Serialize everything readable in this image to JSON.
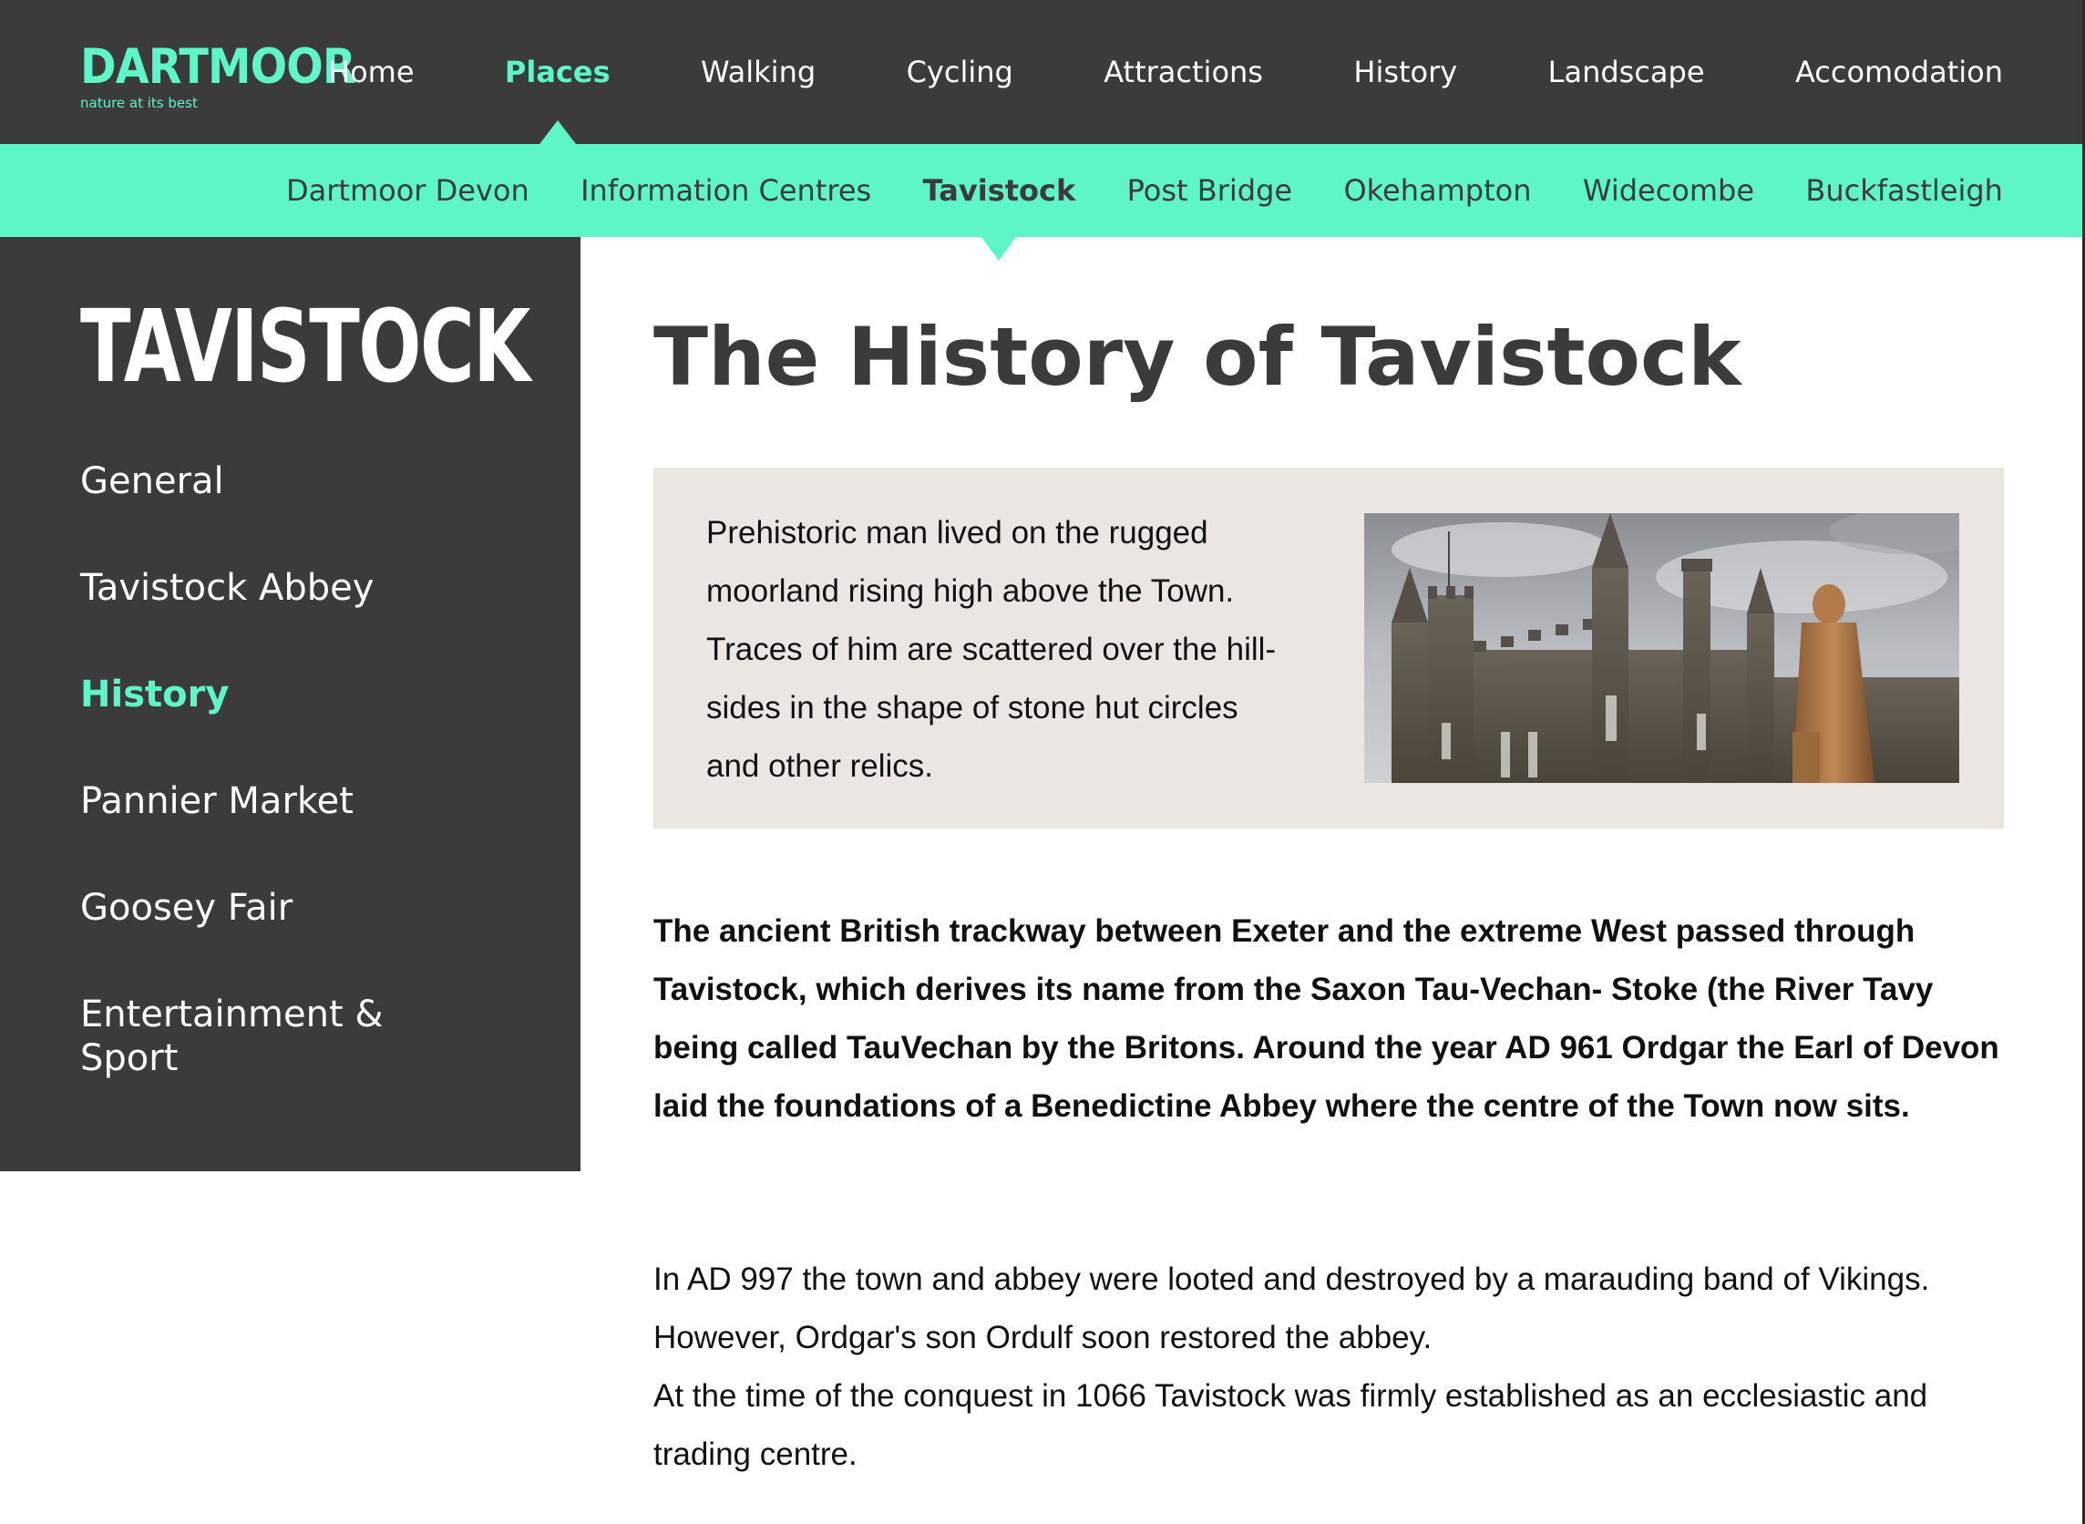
{
  "logo": {
    "wordmark": "DARTMOOR",
    "tagline": "nature at its best"
  },
  "main_nav": {
    "items": [
      {
        "label": "Home"
      },
      {
        "label": "Places"
      },
      {
        "label": "Walking"
      },
      {
        "label": "Cycling"
      },
      {
        "label": "Attractions"
      },
      {
        "label": "History"
      },
      {
        "label": "Landscape"
      },
      {
        "label": "Accomodation"
      }
    ],
    "active": "Places"
  },
  "sub_nav": {
    "items": [
      {
        "label": "Dartmoor Devon"
      },
      {
        "label": "Information Centres"
      },
      {
        "label": "Tavistock"
      },
      {
        "label": "Post Bridge"
      },
      {
        "label": "Okehampton"
      },
      {
        "label": "Widecombe"
      },
      {
        "label": "Buckfastleigh"
      }
    ],
    "active": "Tavistock"
  },
  "sidebar": {
    "title": "TAVISTOCK",
    "items": [
      {
        "label": "General"
      },
      {
        "label": "Tavistock Abbey"
      },
      {
        "label": "History"
      },
      {
        "label": "Pannier Market"
      },
      {
        "label": "Goosey Fair"
      },
      {
        "label": "Entertainment & Sport"
      }
    ],
    "active": "History"
  },
  "main": {
    "title": "The History of Tavistock",
    "intro": "Prehistoric man lived on the rugged moorland rising high above the Town. Traces of him are scattered over the hill-sides in the shape of stone hut circles and other relics.",
    "lead": "The ancient British trackway between Exeter and the extreme West passed through Tavistock, which derives its name from the Saxon Tau-Vechan- Stoke (the River Tavy being called TauVechan by the Britons. Around the year AD 961 Ordgar the Earl of Devon laid the foundations of a Benedictine Abbey where the centre of the Town now sits.",
    "paragraph_1": "In AD 997 the town and abbey were looted and destroyed by a marauding band of Vikings. However, Ordgar's son Ordulf soon restored the abbey.",
    "paragraph_2": "At the time of the conquest in 1066 Tavistock was firmly established as an ecclesiastic and trading centre."
  },
  "colors": {
    "accent": "#5ef5c8",
    "dark": "#3b3b3b",
    "intro_box": "#ebe6e1"
  }
}
